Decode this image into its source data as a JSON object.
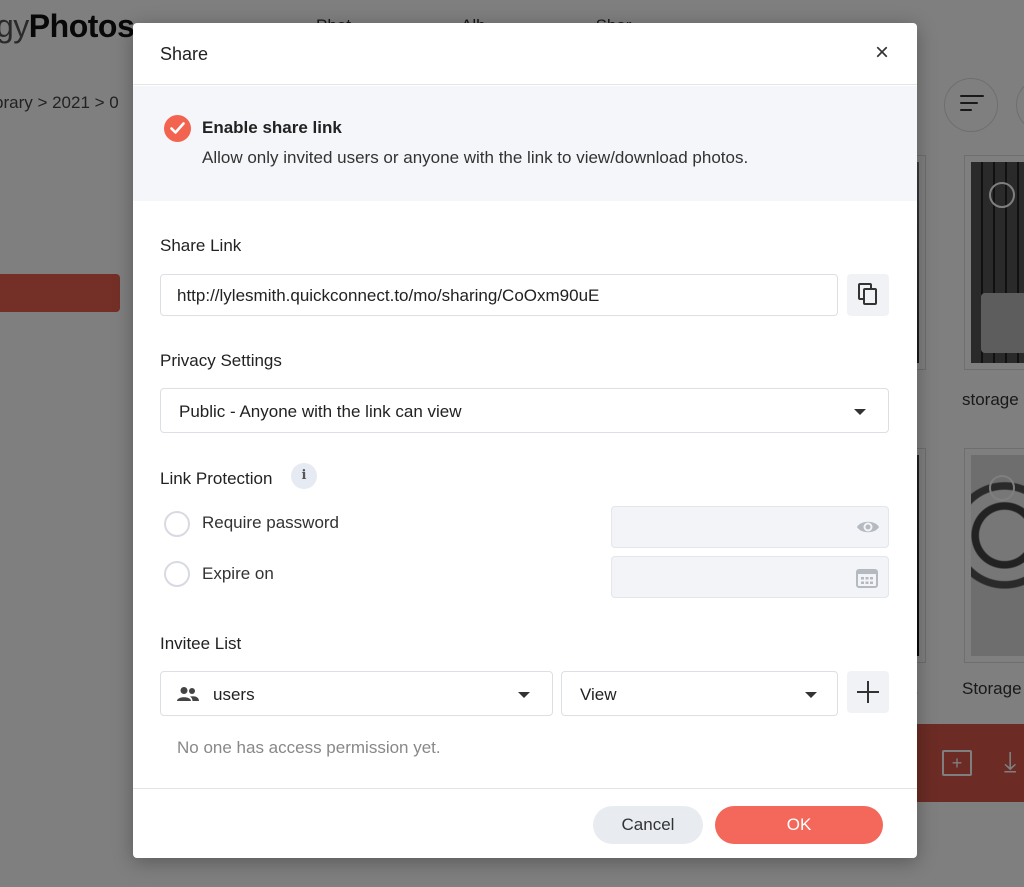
{
  "background": {
    "app_title_part1": "gy",
    "app_title_part2": "Photos",
    "nav": [
      "Phot",
      "Alb",
      "Shar"
    ],
    "breadcrumb": "brary > 2021 > 0",
    "photo_labels": [
      "storage",
      "Storage",
      "."
    ]
  },
  "dialog": {
    "title": "Share",
    "close_label": "×",
    "enable": {
      "title": "Enable share link",
      "description": "Allow only invited users or anyone with the link to view/download photos.",
      "checked": true
    },
    "share_link": {
      "label": "Share Link",
      "url": "http://lylesmith.quickconnect.to/mo/sharing/CoOxm90uE",
      "copy_icon": "copy-icon"
    },
    "privacy": {
      "label": "Privacy Settings",
      "selected": "Public - Anyone with the link can view"
    },
    "link_protection": {
      "label": "Link Protection",
      "info_icon": "i",
      "options": [
        {
          "label": "Require password",
          "checked": false,
          "field_icon": "eye-icon"
        },
        {
          "label": "Expire on",
          "checked": false,
          "field_icon": "calendar-icon"
        }
      ]
    },
    "invitee": {
      "label": "Invitee List",
      "user_type": "users",
      "permission": "View",
      "empty_message": "No one has access permission yet."
    },
    "footer": {
      "cancel_label": "Cancel",
      "ok_label": "OK"
    }
  },
  "colors": {
    "accent": "#f3685a",
    "check": "#f26450",
    "overlay": "rgba(0,0,0,0.5)"
  }
}
